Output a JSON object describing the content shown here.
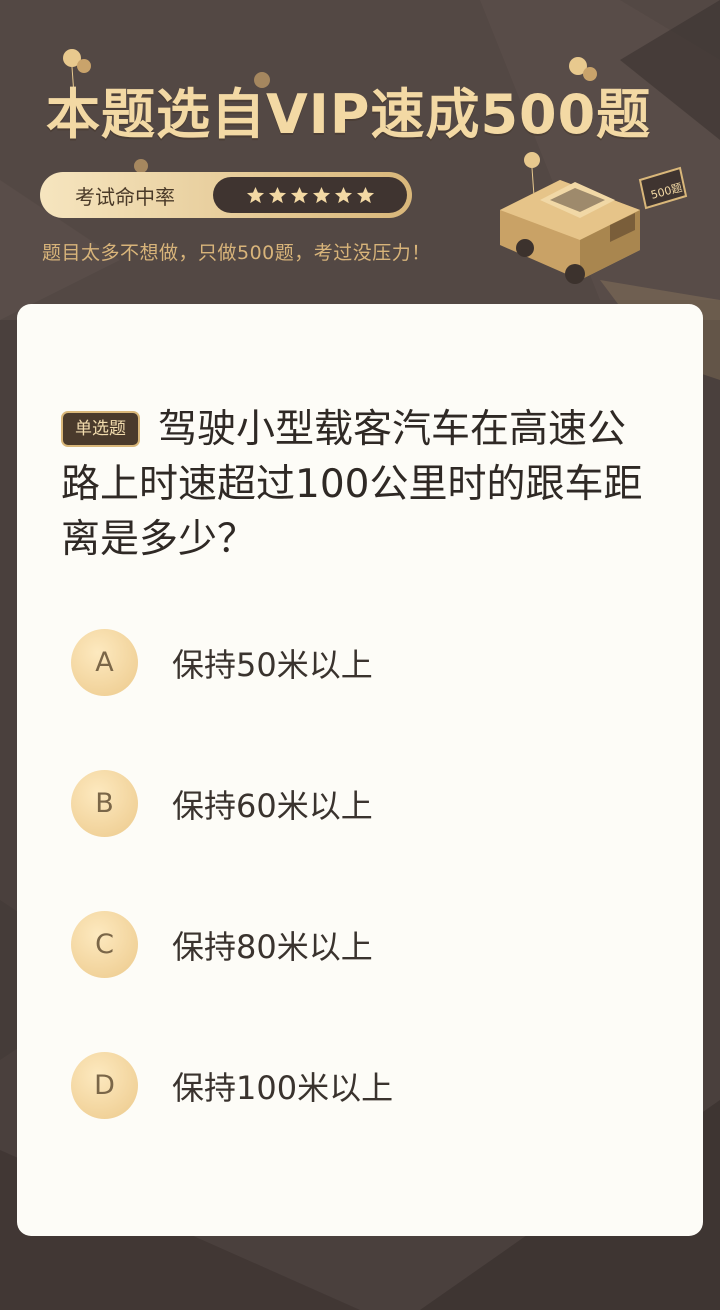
{
  "header": {
    "title": "本题选自VIP速成500题",
    "rate_label": "考试命中率",
    "stars": 6,
    "slogan": "题目太多不想做，只做500题，考过没压力！",
    "car_tag": "500题"
  },
  "question": {
    "badge": "单选题",
    "text": "驾驶小型载客汽车在高速公路上时速超过100公里时的跟车距离是多少？"
  },
  "options": [
    {
      "letter": "A",
      "text": "保持50米以上"
    },
    {
      "letter": "B",
      "text": "保持60米以上"
    },
    {
      "letter": "C",
      "text": "保持80米以上"
    },
    {
      "letter": "D",
      "text": "保持100米以上"
    }
  ],
  "colors": {
    "background": "#4a403d",
    "gold": "#f3d9a4",
    "card": "#fdfcf7"
  }
}
